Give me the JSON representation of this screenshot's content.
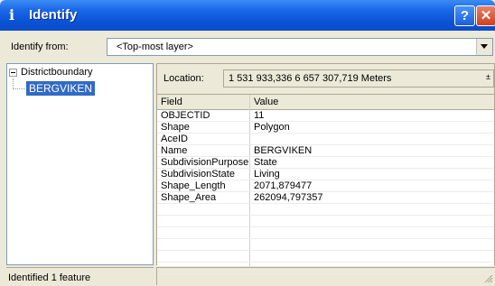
{
  "window": {
    "title": "Identify",
    "title_icon": "i",
    "help_label": "?",
    "close_label": "✕"
  },
  "identify_from": {
    "label": "Identify from:",
    "value": "<Top-most layer>"
  },
  "tree": {
    "root_label": "Districtboundary",
    "child_label": "BERGVIKEN"
  },
  "location": {
    "label": "Location:",
    "value": "1 531 933,336  6 657 307,719 Meters"
  },
  "table": {
    "headers": [
      "Field",
      "Value"
    ],
    "rows": [
      {
        "field": "OBJECTID",
        "value": "11"
      },
      {
        "field": "Shape",
        "value": "Polygon"
      },
      {
        "field": "AceID",
        "value": ""
      },
      {
        "field": "Name",
        "value": "BERGVIKEN"
      },
      {
        "field": "SubdivisionPurpose",
        "value": "State"
      },
      {
        "field": "SubdivisionState",
        "value": "Living"
      },
      {
        "field": "Shape_Length",
        "value": "2071,879477"
      },
      {
        "field": "Shape_Area",
        "value": "262094,797357"
      }
    ]
  },
  "status": {
    "text": "Identified 1 feature"
  },
  "colors": {
    "titlebar": "#0a53d6",
    "selection": "#316ac5",
    "dialog_bg": "#ece9d8"
  }
}
